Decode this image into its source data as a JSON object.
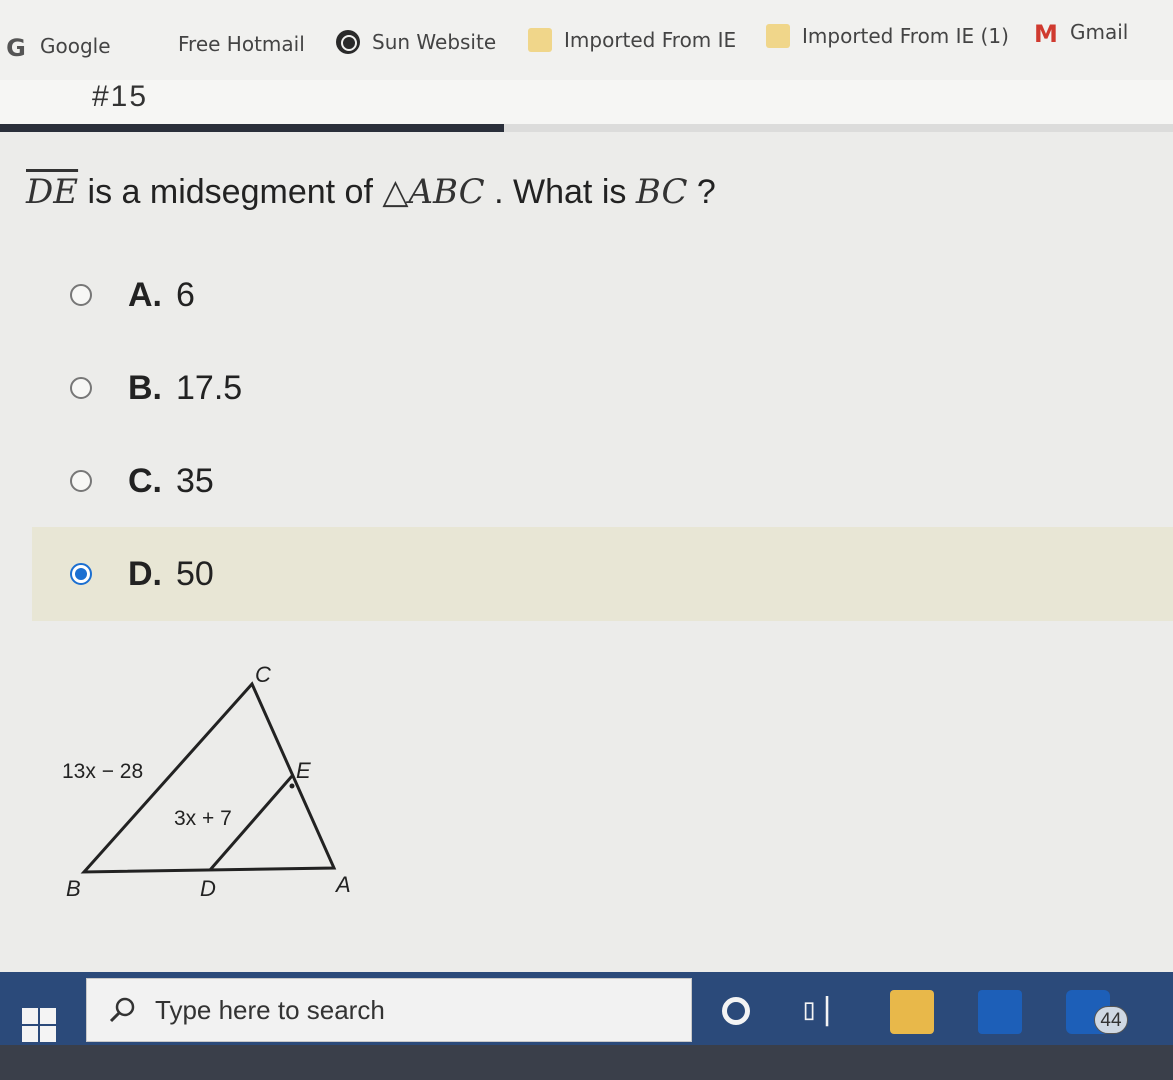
{
  "bookmarks": [
    {
      "label": "Google",
      "icon": "google-g-icon"
    },
    {
      "label": "Free Hotmail",
      "icon": "windows-tiles-icon"
    },
    {
      "label": "Sun Website",
      "icon": "globe-icon"
    },
    {
      "label": "Imported From IE",
      "icon": "folder-icon"
    },
    {
      "label": "Imported From IE (1)",
      "icon": "folder-icon"
    },
    {
      "label": "Gmail",
      "icon": "gmail-icon"
    }
  ],
  "header": {
    "question_number": "#15"
  },
  "progress": {
    "fraction": 0.43
  },
  "question": {
    "segment": "DE",
    "part1": " is a midsegment of ",
    "triangle": "△ABC",
    "part2": " . What is ",
    "target": "BC",
    "part3": " ?"
  },
  "choices": [
    {
      "letter": "A.",
      "value": "6",
      "selected": false
    },
    {
      "letter": "B.",
      "value": "17.5",
      "selected": false
    },
    {
      "letter": "C.",
      "value": "35",
      "selected": false
    },
    {
      "letter": "D.",
      "value": "50",
      "selected": true
    }
  ],
  "figure": {
    "vertices": {
      "A": "A",
      "B": "B",
      "C": "C",
      "D": "D",
      "E": "E"
    },
    "label_bc": "13x − 28",
    "label_de": "3x + 7"
  },
  "taskbar": {
    "search_placeholder": "Type here to search",
    "mail_badge": "44"
  },
  "colors": {
    "accent": "#1b6fd1",
    "selected_bg": "#e8e6d5",
    "progress": "#2a2f3a",
    "taskbar": "#2b4a7a"
  }
}
